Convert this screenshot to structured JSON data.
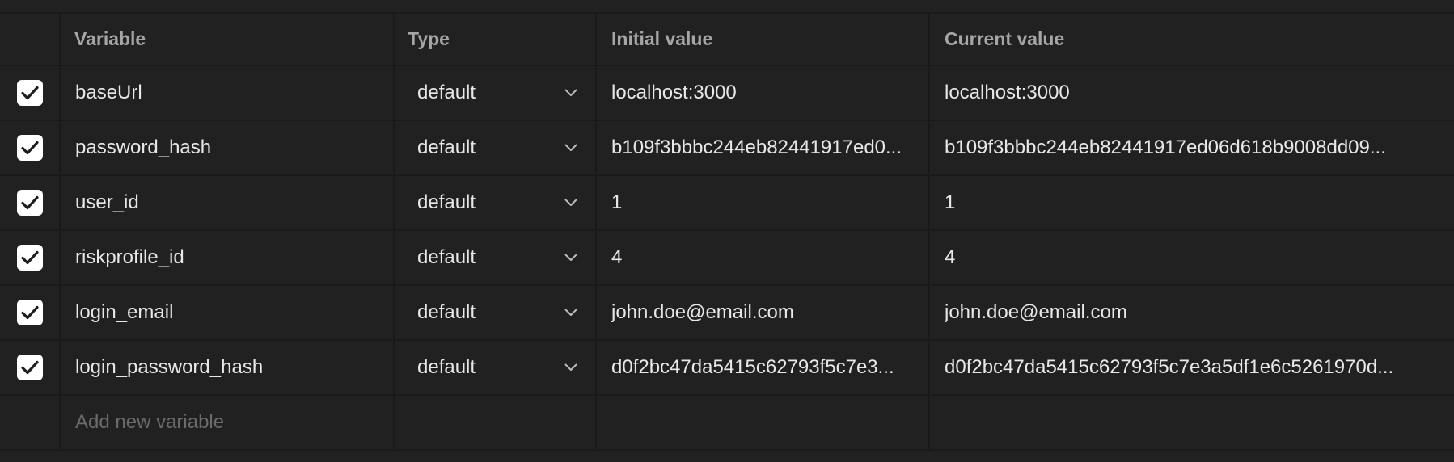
{
  "headers": {
    "variable": "Variable",
    "type": "Type",
    "initial": "Initial value",
    "current": "Current value"
  },
  "rows": [
    {
      "enabled": true,
      "variable": "baseUrl",
      "type": "default",
      "initial": "localhost:3000",
      "current": "localhost:3000"
    },
    {
      "enabled": true,
      "variable": "password_hash",
      "type": "default",
      "initial": "b109f3bbbc244eb82441917ed0...",
      "current": "b109f3bbbc244eb82441917ed06d618b9008dd09..."
    },
    {
      "enabled": true,
      "variable": "user_id",
      "type": "default",
      "initial": "1",
      "current": "1"
    },
    {
      "enabled": true,
      "variable": "riskprofile_id",
      "type": "default",
      "initial": "4",
      "current": "4"
    },
    {
      "enabled": true,
      "variable": "login_email",
      "type": "default",
      "initial": "john.doe@email.com",
      "current": "john.doe@email.com"
    },
    {
      "enabled": true,
      "variable": "login_password_hash",
      "type": "default",
      "initial": "d0f2bc47da5415c62793f5c7e3...",
      "current": "d0f2bc47da5415c62793f5c7e3a5df1e6c5261970d..."
    }
  ],
  "add_row": {
    "placeholder": "Add new variable"
  },
  "icons": {
    "checkbox": "checkmark-icon",
    "type_dropdown": "chevron-down-icon"
  },
  "colors": {
    "background": "#212121",
    "grid": "#1a1a1a",
    "header_text": "#a6a6a6",
    "cell_text": "#e8e8e8",
    "placeholder_text": "#6b6b6b"
  }
}
